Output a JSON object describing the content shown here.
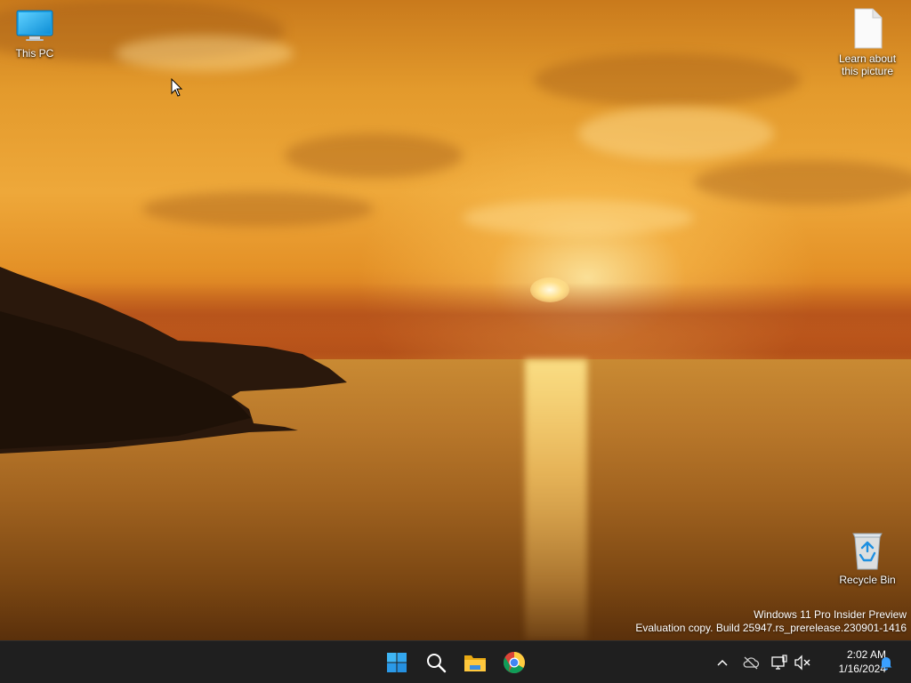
{
  "desktop": {
    "icons": [
      {
        "label": "This PC",
        "icon": "monitor-icon"
      },
      {
        "label": "Learn about this picture",
        "label_line1": "Learn about",
        "label_line2": "this picture",
        "icon": "document-icon"
      },
      {
        "label": "Recycle Bin",
        "icon": "recycle-bin-icon"
      }
    ],
    "watermark": {
      "line1": "Windows 11 Pro Insider Preview",
      "line2": "Evaluation copy. Build 25947.rs_prerelease.230901-1416"
    }
  },
  "taskbar": {
    "pinned": [
      {
        "name": "Start",
        "icon": "windows-logo-icon"
      },
      {
        "name": "Search",
        "icon": "search-icon"
      },
      {
        "name": "File Explorer",
        "icon": "folder-icon"
      },
      {
        "name": "Google Chrome",
        "icon": "chrome-icon"
      }
    ],
    "tray": [
      {
        "name": "Show hidden icons",
        "icon": "chevron-up-icon"
      },
      {
        "name": "OneDrive",
        "icon": "cloud-off-icon"
      },
      {
        "name": "Network",
        "icon": "network-icon"
      },
      {
        "name": "Volume",
        "icon": "speaker-muted-icon"
      }
    ],
    "clock": {
      "time": "2:02 AM",
      "date": "1/16/2024"
    },
    "notifications_icon": "bell-icon"
  },
  "colors": {
    "taskbar": "#1f1f1f",
    "accent": "#0078d4"
  }
}
